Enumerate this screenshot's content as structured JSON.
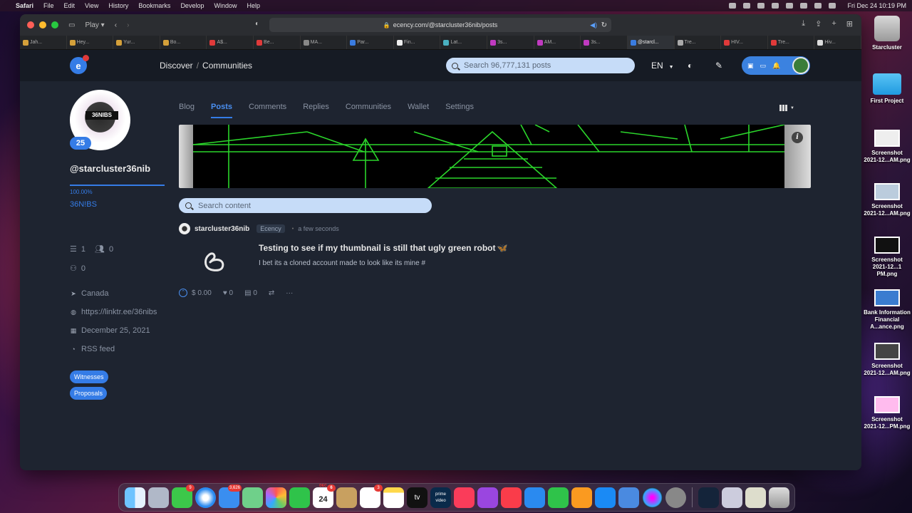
{
  "menubar": {
    "apple": "",
    "items": [
      "Safari",
      "File",
      "Edit",
      "View",
      "History",
      "Bookmarks",
      "Develop",
      "Window",
      "Help"
    ],
    "clock": "Fri Dec 24  10:19 PM"
  },
  "browser": {
    "sidebar_label": "Play",
    "url": "ecency.com/@starcluster36nib/posts",
    "tabs": [
      {
        "label": "Jah...",
        "color": "#d4a03a"
      },
      {
        "label": "Hey...",
        "color": "#d4a03a"
      },
      {
        "label": "Yur...",
        "color": "#d4a03a"
      },
      {
        "label": "Bo...",
        "color": "#d4a03a"
      },
      {
        "label": "A$...",
        "color": "#e03a3a"
      },
      {
        "label": "Be...",
        "color": "#e03a3a"
      },
      {
        "label": "MA...",
        "color": "#888888"
      },
      {
        "label": "Par...",
        "color": "#3a7ce0"
      },
      {
        "label": "Fin...",
        "color": "#eeeeee"
      },
      {
        "label": "Lat...",
        "color": "#4ab0c0"
      },
      {
        "label": "3s...",
        "color": "#c03ac0"
      },
      {
        "label": "AM...",
        "color": "#c03ac0"
      },
      {
        "label": "3s...",
        "color": "#c03ac0"
      },
      {
        "label": "@starcl...",
        "color": "#3a7ce0",
        "active": true
      },
      {
        "label": "Tre...",
        "color": "#aaaaaa"
      },
      {
        "label": "HIV...",
        "color": "#e03a3a"
      },
      {
        "label": "Tre...",
        "color": "#e03a3a"
      },
      {
        "label": "Hiv...",
        "color": "#dddddd"
      }
    ]
  },
  "site": {
    "breadcrumb": {
      "discover": "Discover",
      "separator": "/",
      "communities": "Communities"
    },
    "search_placeholder": "Search 96,777,131 posts",
    "lang": "EN"
  },
  "profile": {
    "reputation": "25",
    "avatar_text": "36NIBS",
    "username": "@starcluster36nib",
    "voting_power": "100.00%",
    "display_name": "36N!BS",
    "posts_count": "1",
    "followers": "0",
    "following": "0",
    "location": "Canada",
    "website": "https://linktr.ee/36nibs",
    "joined": "December 25, 2021",
    "rss": "RSS feed",
    "witnesses": "Witnesses",
    "proposals": "Proposals"
  },
  "tabs": [
    "Blog",
    "Posts",
    "Comments",
    "Replies",
    "Communities",
    "Wallet",
    "Settings"
  ],
  "active_tab": "Posts",
  "content_search_placeholder": "Search content",
  "post": {
    "author": "starcluster36nib",
    "community": "Ecency",
    "separator": "•",
    "time": "a few seconds",
    "title": "Testing to see if my thumbnail is still that ugly green robot",
    "title_emoji": "🦋",
    "body": "I bet its a cloned account made to look like its mine #",
    "payout": "$ 0.00",
    "votes": "0",
    "comments": "0"
  },
  "desktop": [
    {
      "label": "Starcluster"
    },
    {
      "label": "First Project"
    },
    {
      "label": "Screenshot\n2021-12...AM.png"
    },
    {
      "label": "Screenshot\n2021-12...AM.png"
    },
    {
      "label": "Screenshot\n2021-12...1 PM.png"
    },
    {
      "label": "Bank Information\nFinancial A...ance.png"
    },
    {
      "label": "Screenshot\n2021-12...AM.png"
    },
    {
      "label": "Screenshot\n2021-12...PM.png"
    }
  ],
  "dock": {
    "calendar_month": "DEC",
    "calendar_day": "24",
    "badges": {
      "messages": "9",
      "mail": "3,626",
      "calendar": "6",
      "reminders": "3"
    },
    "appletv": "tv",
    "prime": "prime video"
  },
  "colors": {
    "accent": "#357ce6",
    "bg": "#1e2430",
    "header": "#161b24",
    "search": "#c6dcf8"
  }
}
